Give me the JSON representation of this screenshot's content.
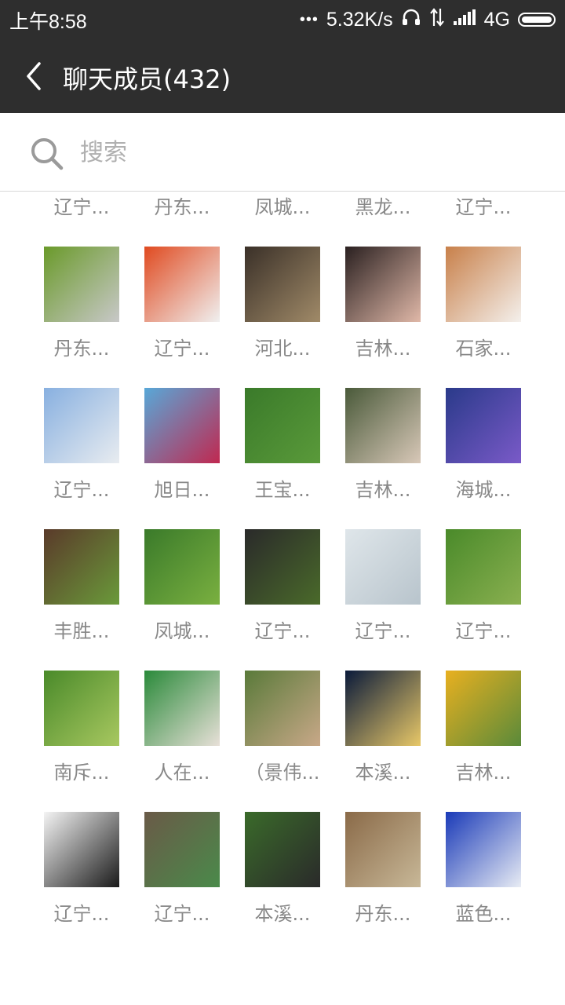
{
  "status_bar": {
    "time": "上午8:58",
    "speed": "5.32K/s",
    "network": "4G",
    "icons": [
      "dots-icon",
      "headphones-icon",
      "data-arrows-icon",
      "signal-icon",
      "battery-icon"
    ]
  },
  "header": {
    "title": "聊天成员(432)",
    "back_icon": "back-chevron-icon"
  },
  "search": {
    "placeholder": "搜索",
    "value": ""
  },
  "colors": {
    "header_bg": "#2e2e2e",
    "name_text": "#888888"
  },
  "members": [
    {
      "name": "辽宁...",
      "avatar": [
        "#c85a6e",
        "#7aa24a"
      ]
    },
    {
      "name": "丹东...",
      "avatar": [
        "#3c5a2a",
        "#8fb04a"
      ]
    },
    {
      "name": "凤城...",
      "avatar": [
        "#f2f2f2",
        "#2a2a2a"
      ]
    },
    {
      "name": "黑龙...",
      "avatar": [
        "#4a2a4a",
        "#9ab03a"
      ]
    },
    {
      "name": "辽宁...",
      "avatar": [
        "#e8c020",
        "#5a8a2a"
      ]
    },
    {
      "name": "丹东...",
      "avatar": [
        "#6a9a2a",
        "#c8c8c8"
      ]
    },
    {
      "name": "辽宁...",
      "avatar": [
        "#e04a20",
        "#f0f0f0"
      ]
    },
    {
      "name": "河北...",
      "avatar": [
        "#3a3028",
        "#a08a68"
      ]
    },
    {
      "name": "吉林...",
      "avatar": [
        "#2a2020",
        "#e0b8a8"
      ]
    },
    {
      "name": "石家...",
      "avatar": [
        "#c8804a",
        "#f4f0ec"
      ]
    },
    {
      "name": "辽宁...",
      "avatar": [
        "#88b0e0",
        "#e8ecf0"
      ]
    },
    {
      "name": "旭日...",
      "avatar": [
        "#58a8d8",
        "#c02850"
      ]
    },
    {
      "name": "王宝...",
      "avatar": [
        "#3a7a2a",
        "#5a9a3a"
      ]
    },
    {
      "name": "吉林...",
      "avatar": [
        "#4a5a3a",
        "#d8c8b8"
      ]
    },
    {
      "name": "海城...",
      "avatar": [
        "#2a3a8a",
        "#7a5ac8"
      ]
    },
    {
      "name": "丰胜...",
      "avatar": [
        "#5a3a2a",
        "#6a9a3a"
      ]
    },
    {
      "name": "凤城...",
      "avatar": [
        "#3a7a2a",
        "#7ab040"
      ]
    },
    {
      "name": "辽宁...",
      "avatar": [
        "#2a2a2a",
        "#4a6a2a"
      ]
    },
    {
      "name": "辽宁...",
      "avatar": [
        "#dfe6ea",
        "#b8c4cc"
      ]
    },
    {
      "name": "辽宁...",
      "avatar": [
        "#4a8a2a",
        "#8ab050"
      ]
    },
    {
      "name": "南斥...",
      "avatar": [
        "#4a8a2a",
        "#a8c860"
      ]
    },
    {
      "name": "人在...",
      "avatar": [
        "#2a8a3a",
        "#e8e0d8"
      ]
    },
    {
      "name": "（景伟...",
      "avatar": [
        "#5a7a3a",
        "#c8a888"
      ]
    },
    {
      "name": "本溪...",
      "avatar": [
        "#0a1a3a",
        "#e8c868"
      ]
    },
    {
      "name": "吉林...",
      "avatar": [
        "#e8b020",
        "#5a8a3a"
      ]
    },
    {
      "name": "辽宁...",
      "avatar": [
        "#f4f4f4",
        "#1a1a1a"
      ]
    },
    {
      "name": "辽宁...",
      "avatar": [
        "#6a5a48",
        "#4a8a4a"
      ]
    },
    {
      "name": "本溪...",
      "avatar": [
        "#3a6a2a",
        "#2a2a2a"
      ]
    },
    {
      "name": "丹东...",
      "avatar": [
        "#8a6a48",
        "#c8b898"
      ]
    },
    {
      "name": "蓝色...",
      "avatar": [
        "#1a3ab8",
        "#e8ecf4"
      ]
    }
  ]
}
